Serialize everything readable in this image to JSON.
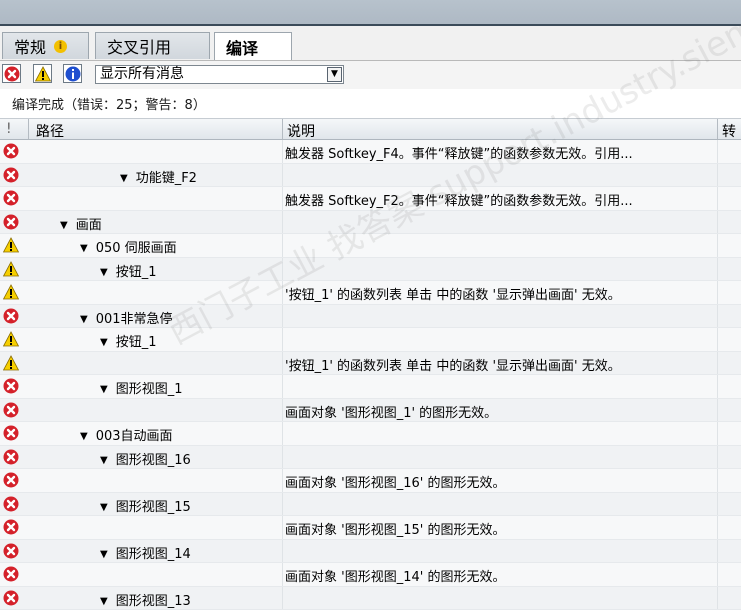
{
  "tabs": [
    {
      "label": "常规",
      "active": false
    },
    {
      "label": "交叉引用",
      "active": false
    },
    {
      "label": "编译",
      "active": true
    }
  ],
  "toolbar": {
    "filter_error_icon": "error-icon",
    "filter_warning_icon": "warning-icon",
    "filter_info_icon": "info-icon",
    "dropdown_value": "显示所有消息"
  },
  "status_text": "编译完成（错误：25；警告：8）",
  "columns": {
    "col0": "!",
    "col1": "路径",
    "col2": "说明",
    "col3": "转"
  },
  "rows": [
    {
      "icon": "error",
      "indent": 0,
      "path": "",
      "description": "触发器 Softkey_F4。事件“释放键”的函数参数无效。引用..."
    },
    {
      "icon": "error",
      "indent": 4,
      "path": "功能键_F2",
      "description": ""
    },
    {
      "icon": "error",
      "indent": 0,
      "path": "",
      "description": "触发器 Softkey_F2。事件“释放键”的函数参数无效。引用..."
    },
    {
      "icon": "error",
      "indent": 1,
      "path": "画面",
      "description": ""
    },
    {
      "icon": "warning",
      "indent": 2,
      "path": "050 伺服画面",
      "description": ""
    },
    {
      "icon": "warning",
      "indent": 3,
      "path": "按钮_1",
      "description": ""
    },
    {
      "icon": "warning",
      "indent": 0,
      "path": "",
      "description": "'按钮_1' 的函数列表 单击 中的函数 '显示弹出画面' 无效。"
    },
    {
      "icon": "error",
      "indent": 2,
      "path": "001非常急停",
      "description": ""
    },
    {
      "icon": "warning",
      "indent": 3,
      "path": "按钮_1",
      "description": ""
    },
    {
      "icon": "warning",
      "indent": 0,
      "path": "",
      "description": "'按钮_1' 的函数列表 单击 中的函数 '显示弹出画面' 无效。"
    },
    {
      "icon": "error",
      "indent": 3,
      "path": "图形视图_1",
      "description": ""
    },
    {
      "icon": "error",
      "indent": 0,
      "path": "",
      "description": "画面对象 '图形视图_1' 的图形无效。"
    },
    {
      "icon": "error",
      "indent": 2,
      "path": "003自动画面",
      "description": ""
    },
    {
      "icon": "error",
      "indent": 3,
      "path": "图形视图_16",
      "description": ""
    },
    {
      "icon": "error",
      "indent": 0,
      "path": "",
      "description": "画面对象 '图形视图_16' 的图形无效。"
    },
    {
      "icon": "error",
      "indent": 3,
      "path": "图形视图_15",
      "description": ""
    },
    {
      "icon": "error",
      "indent": 0,
      "path": "",
      "description": "画面对象 '图形视图_15' 的图形无效。"
    },
    {
      "icon": "error",
      "indent": 3,
      "path": "图形视图_14",
      "description": ""
    },
    {
      "icon": "error",
      "indent": 0,
      "path": "",
      "description": "画面对象 '图形视图_14' 的图形无效。"
    },
    {
      "icon": "error",
      "indent": 3,
      "path": "图形视图_13",
      "description": ""
    }
  ],
  "watermark": "西门子工业 找答案 support.industry.siemens.com/cs"
}
